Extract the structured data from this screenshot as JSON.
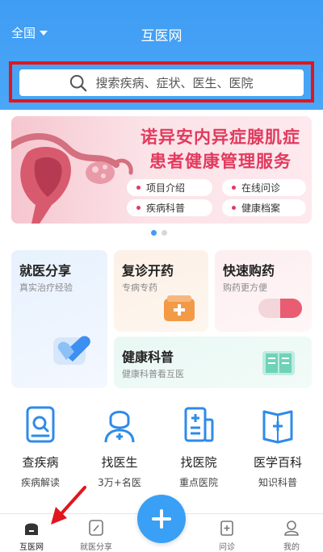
{
  "header": {
    "city": "全国",
    "title": "互医网"
  },
  "search": {
    "placeholder": "搜索疾病、症状、医生、医院"
  },
  "banner": {
    "title_line1": "诺异安内异症腺肌症",
    "title_line2": "患者健康管理服务",
    "pills": [
      "项目介绍",
      "在线问诊",
      "疾病科普",
      "健康档案"
    ],
    "page_count": 2,
    "active_page": 1
  },
  "cards": {
    "share": {
      "title": "就医分享",
      "subtitle": "真实治疗经验"
    },
    "refill": {
      "title": "复诊开药",
      "subtitle": "专病专药"
    },
    "buy": {
      "title": "快速购药",
      "subtitle": "购药更方便"
    },
    "science": {
      "title": "健康科普",
      "subtitle": "健康科普看互医"
    }
  },
  "quick": [
    {
      "title": "查疾病",
      "subtitle": "疾病解读",
      "icon": "disease-doc-icon"
    },
    {
      "title": "找医生",
      "subtitle": "3万+名医",
      "icon": "doctor-icon"
    },
    {
      "title": "找医院",
      "subtitle": "重点医院",
      "icon": "hospital-icon"
    },
    {
      "title": "医学百科",
      "subtitle": "知识科普",
      "icon": "encyclopedia-icon"
    }
  ],
  "tabs": [
    {
      "label": "互医网",
      "icon": "home-icon"
    },
    {
      "label": "就医分享",
      "icon": "edit-icon"
    },
    {
      "label": "",
      "icon": "plus-icon"
    },
    {
      "label": "问诊",
      "icon": "consult-icon"
    },
    {
      "label": "我的",
      "icon": "profile-icon"
    }
  ],
  "colors": {
    "brand_blue": "#3f9df4",
    "banner_red": "#e23a5e",
    "highlight_red": "#e0161e"
  }
}
